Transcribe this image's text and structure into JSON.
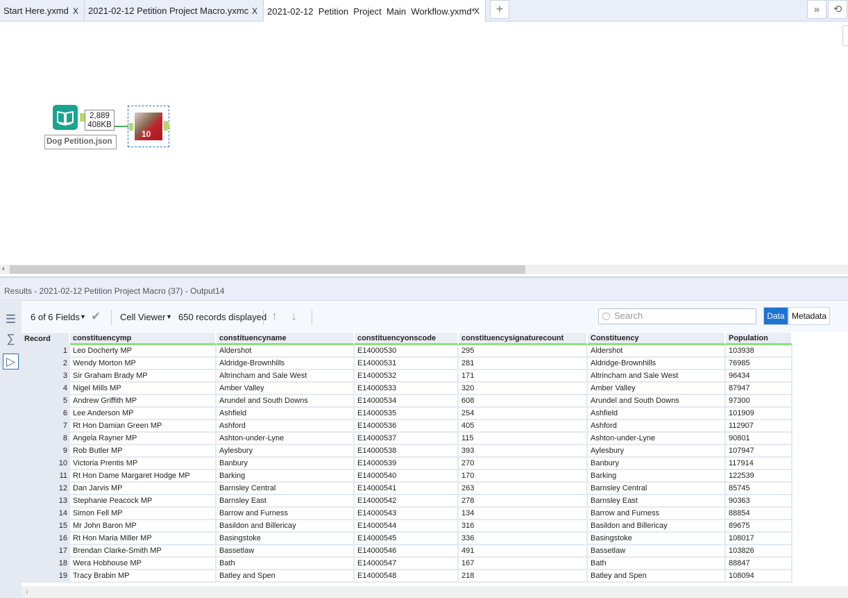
{
  "tabs": [
    {
      "label": "Start Here.yxmd",
      "close": "X"
    },
    {
      "label": "2021-02-12 Petition Project Macro.yxmc",
      "close": "X"
    },
    {
      "label": "2021-02-12  Petition  Project  Main  Workflow.yxmd*",
      "close": "X"
    }
  ],
  "tab_controls": {
    "add": "+",
    "overflow": "»",
    "history": "⟲"
  },
  "canvas": {
    "input_tool": {
      "label": "Dog Petition.json",
      "records": "2,889",
      "size": "408KB"
    },
    "macro_tool": {
      "jersey": "10"
    }
  },
  "results": {
    "title": "Results - 2021-02-12 Petition Project Macro (37) - Output14",
    "fields": "6 of 6 Fields",
    "cell_viewer": "Cell Viewer",
    "records_displayed": "650 records displayed",
    "search_placeholder": "Search",
    "data_btn": "Data",
    "metadata_btn": "Metadata",
    "columns": [
      "Record",
      "constituencymp",
      "constituencyname",
      "constituencyonscode",
      "constituencysignaturecount",
      "Constituency",
      "Population"
    ],
    "rows": [
      [
        "1",
        "Leo Docherty MP",
        "Aldershot",
        "E14000530",
        "295",
        "Aldershot",
        "103938"
      ],
      [
        "2",
        "Wendy Morton MP",
        "Aldridge-Brownhills",
        "E14000531",
        "281",
        "Aldridge-Brownhills",
        "76985"
      ],
      [
        "3",
        "Sir Graham Brady MP",
        "Altrincham and Sale West",
        "E14000532",
        "171",
        "Altrincham and Sale West",
        "96434"
      ],
      [
        "4",
        "Nigel Mills MP",
        "Amber Valley",
        "E14000533",
        "320",
        "Amber Valley",
        "87947"
      ],
      [
        "5",
        "Andrew Griffith MP",
        "Arundel and South Downs",
        "E14000534",
        "608",
        "Arundel and South Downs",
        "97300"
      ],
      [
        "6",
        "Lee Anderson MP",
        "Ashfield",
        "E14000535",
        "254",
        "Ashfield",
        "101909"
      ],
      [
        "7",
        "Rt Hon Damian Green MP",
        "Ashford",
        "E14000536",
        "405",
        "Ashford",
        "112907"
      ],
      [
        "8",
        "Angela Rayner MP",
        "Ashton-under-Lyne",
        "E14000537",
        "115",
        "Ashton-under-Lyne",
        "90801"
      ],
      [
        "9",
        "Rob Butler MP",
        "Aylesbury",
        "E14000538",
        "393",
        "Aylesbury",
        "107947"
      ],
      [
        "10",
        "Victoria Prentis MP",
        "Banbury",
        "E14000539",
        "270",
        "Banbury",
        "117914"
      ],
      [
        "11",
        "Rt Hon Dame Margaret Hodge MP",
        "Barking",
        "E14000540",
        "170",
        "Barking",
        "122539"
      ],
      [
        "12",
        "Dan Jarvis MP",
        "Barnsley Central",
        "E14000541",
        "263",
        "Barnsley Central",
        "85745"
      ],
      [
        "13",
        "Stephanie Peacock MP",
        "Barnsley East",
        "E14000542",
        "278",
        "Barnsley East",
        "90363"
      ],
      [
        "14",
        "Simon Fell MP",
        "Barrow and Furness",
        "E14000543",
        "134",
        "Barrow and Furness",
        "88854"
      ],
      [
        "15",
        "Mr John Baron MP",
        "Basildon and Billericay",
        "E14000544",
        "316",
        "Basildon and Billericay",
        "89675"
      ],
      [
        "16",
        "Rt Hon Maria Miller MP",
        "Basingstoke",
        "E14000545",
        "336",
        "Basingstoke",
        "108017"
      ],
      [
        "17",
        "Brendan Clarke-Smith MP",
        "Bassetlaw",
        "E14000546",
        "491",
        "Bassetlaw",
        "103826"
      ],
      [
        "18",
        "Wera Hobhouse MP",
        "Bath",
        "E14000547",
        "167",
        "Bath",
        "88847"
      ],
      [
        "19",
        "Tracy Brabin MP",
        "Batley and Spen",
        "E14000548",
        "218",
        "Batley and Spen",
        "108094"
      ]
    ]
  }
}
